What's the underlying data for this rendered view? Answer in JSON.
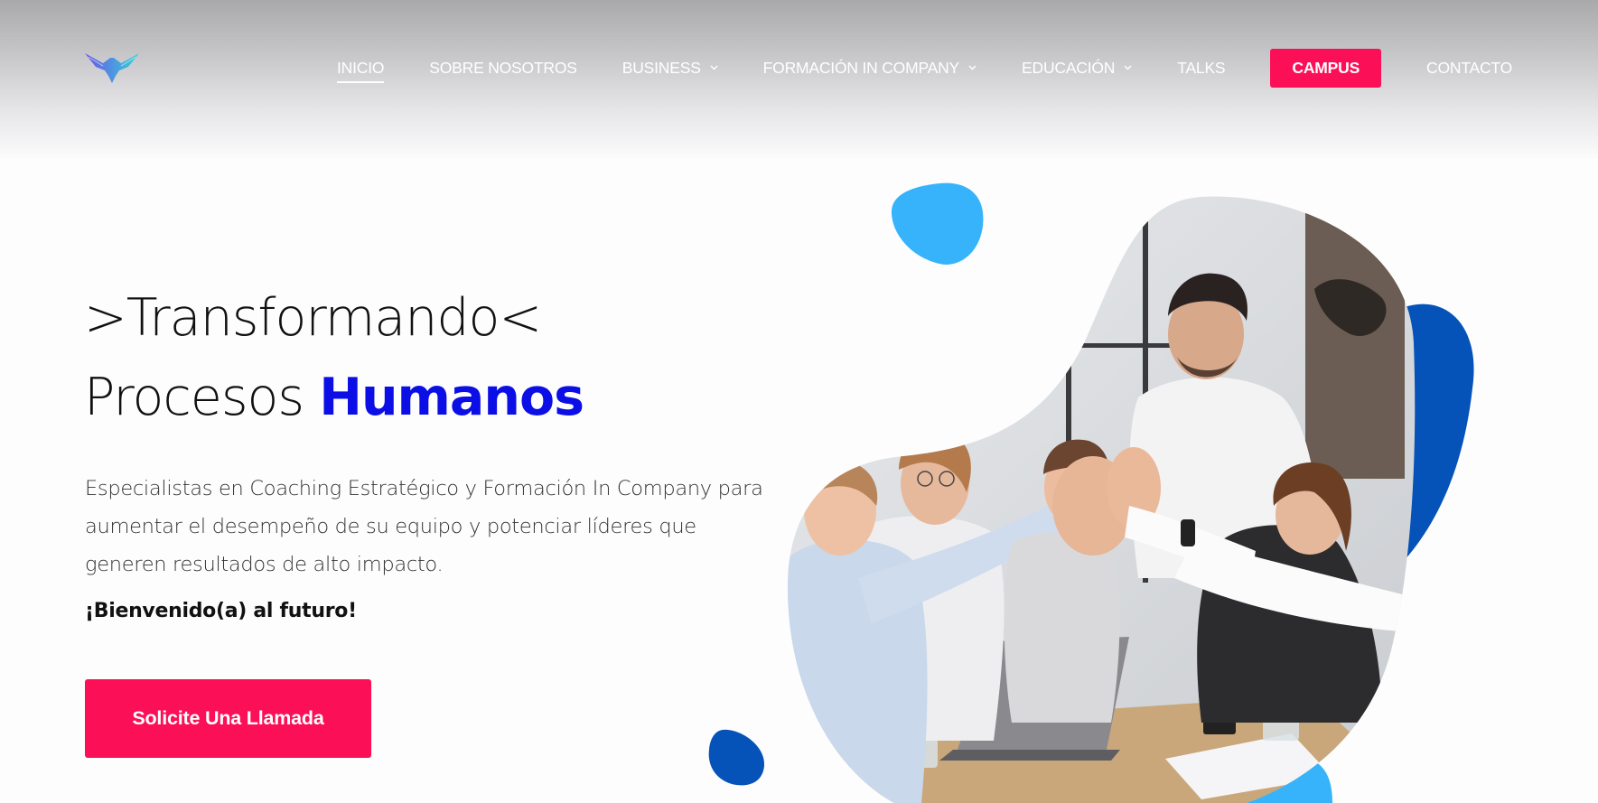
{
  "nav": {
    "items": [
      {
        "label": "INICIO",
        "active": true,
        "dropdown": false
      },
      {
        "label": "SOBRE NOSOTROS",
        "active": false,
        "dropdown": false
      },
      {
        "label": "BUSINESS",
        "active": false,
        "dropdown": true
      },
      {
        "label": "FORMACIÓN IN COMPANY",
        "active": false,
        "dropdown": true
      },
      {
        "label": "EDUCACIÓN",
        "active": false,
        "dropdown": true
      },
      {
        "label": "TALKS",
        "active": false,
        "dropdown": false
      }
    ],
    "campus_label": "CAMPUS",
    "contact_label": "CONTACTO"
  },
  "hero": {
    "title_line1": ">Transformando<",
    "title_line2_prefix": "Procesos ",
    "title_line2_accent": "Humanos",
    "description": "Especialistas en Coaching Estratégico y Formación In Company para aumentar el desempeño de su equipo y potenciar líderes que generen resultados de alto impacto.",
    "welcome": "¡Bienvenido(a) al futuro!",
    "cta_label": "Solicite Una Llamada"
  },
  "colors": {
    "accent_pink": "#fb0f57",
    "accent_blue": "#0b0fe6",
    "blob_light_blue": "#36b3fb",
    "blob_dark_blue": "#0552b9"
  },
  "icons": {
    "logo": "eagle-logo-icon",
    "dropdown": "chevron-down-icon"
  }
}
